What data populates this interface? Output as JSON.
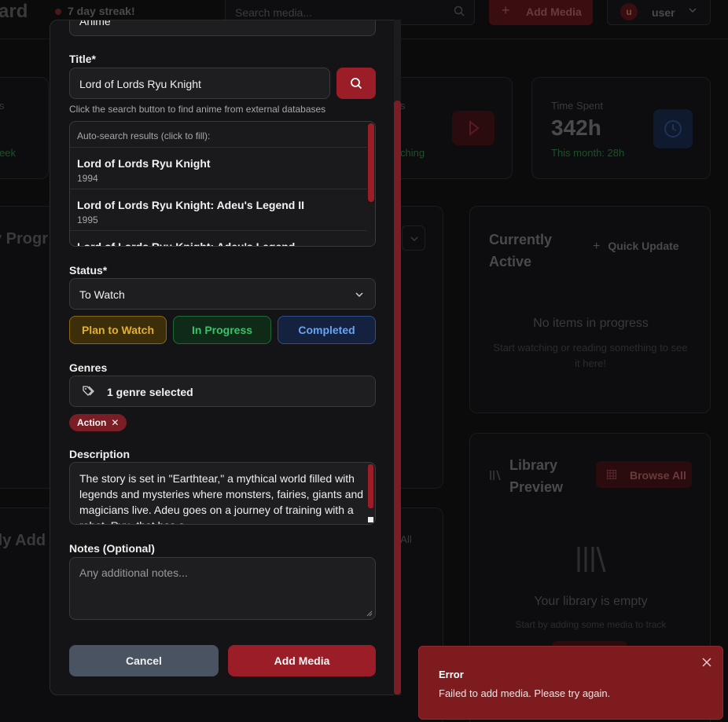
{
  "app": {
    "brand_fragment": "ard",
    "streak": "7 day streak!",
    "search_placeholder": "Search media...",
    "add_media_label": "Add Media",
    "user_initial": "u",
    "user_name": "user"
  },
  "dashboard": {
    "stat_left_label_fragment": "s",
    "stat_left_sub_fragment": "eek",
    "stat_mid_label_fragment": "s",
    "stat_mid_sub_fragment": "ching",
    "time_spent": {
      "label": "Time Spent",
      "value": "342h",
      "sub": "This month: 28h"
    },
    "progress_title_fragment": "y Progr",
    "currently_active": {
      "title": "Currently Active",
      "quick_update": "Quick Update",
      "empty_title": "No items in progress",
      "empty_sub": "Start watching or reading something to see it here!"
    },
    "recently_added_fragment": "tly Add",
    "view_all_fragment": "w All",
    "library_preview": {
      "title": "Library Preview",
      "browse_all": "Browse All",
      "empty_title": "Your library is empty",
      "empty_sub": "Start by adding some media to track"
    }
  },
  "modal": {
    "type_select_value": "Anime",
    "title_label": "Title*",
    "title_value": "Lord of Lords Ryu Knight",
    "search_help": "Click the search button to find anime from external databases",
    "results_header": "Auto-search results (click to fill):",
    "results": [
      {
        "title": "Lord of Lords Ryu Knight",
        "year": "1994"
      },
      {
        "title": "Lord of Lords Ryu Knight: Adeu's Legend II",
        "year": "1995"
      },
      {
        "title": "Lord of Lords Ryu Knight: Adeu's Legend",
        "year": ""
      }
    ],
    "status_label": "Status*",
    "status_value": "To Watch",
    "status_pills": {
      "plan": "Plan to Watch",
      "progress": "In Progress",
      "completed": "Completed"
    },
    "genres_label": "Genres",
    "genres_summary": "1 genre selected",
    "genre_chips": [
      "Action"
    ],
    "description_label": "Description",
    "description_value": "The story is set in \"Earthtear,\" a mythical world filled with legends and mysteries where monsters, fairies, giants and magicians live. Adeu goes on a journey of training with a robot, Ryu, that has a",
    "notes_label": "Notes (Optional)",
    "notes_placeholder": "Any additional notes...",
    "cancel_label": "Cancel",
    "submit_label": "Add Media"
  },
  "toast": {
    "title": "Error",
    "message": "Failed to add media. Please try again."
  },
  "colors": {
    "accent": "#9b1d28",
    "toast_bg": "#7e1b1f",
    "modal_bg": "#141416",
    "page_bg": "#0b0b0c"
  }
}
